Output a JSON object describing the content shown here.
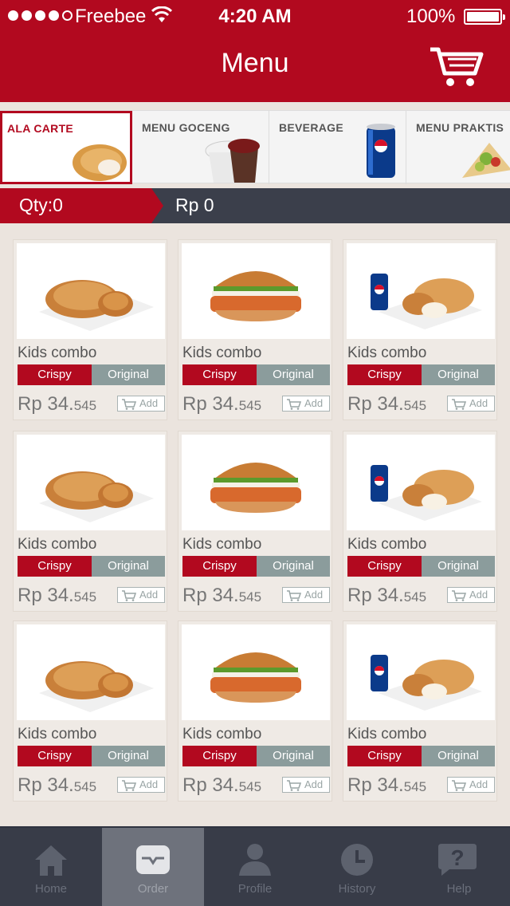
{
  "status": {
    "carrier": "Freebee",
    "time": "4:20 AM",
    "battery": "100%"
  },
  "header": {
    "title": "Menu"
  },
  "categories": [
    {
      "label": "ALA CARTE",
      "active": true
    },
    {
      "label": "MENU GOCENG",
      "active": false
    },
    {
      "label": "BEVERAGE",
      "active": false
    },
    {
      "label": "MENU PRAKTIS",
      "active": false
    }
  ],
  "summary": {
    "qty": "Qty:0",
    "total": "Rp 0"
  },
  "products": [
    {
      "name": "Kids combo",
      "option_a": "Crispy",
      "option_b": "Original",
      "price": "Rp 34.",
      "price_small": "545",
      "add": "Add",
      "image": "fried-chicken"
    },
    {
      "name": "Kids combo",
      "option_a": "Crispy",
      "option_b": "Original",
      "price": "Rp 34.",
      "price_small": "545",
      "add": "Add",
      "image": "chicken-burger"
    },
    {
      "name": "Kids combo",
      "option_a": "Crispy",
      "option_b": "Original",
      "price": "Rp 34.",
      "price_small": "545",
      "add": "Add",
      "image": "combo-with-pepsi"
    },
    {
      "name": "Kids combo",
      "option_a": "Crispy",
      "option_b": "Original",
      "price": "Rp 34.",
      "price_small": "545",
      "add": "Add",
      "image": "fried-chicken"
    },
    {
      "name": "Kids combo",
      "option_a": "Crispy",
      "option_b": "Original",
      "price": "Rp 34.",
      "price_small": "545",
      "add": "Add",
      "image": "chicken-burger"
    },
    {
      "name": "Kids combo",
      "option_a": "Crispy",
      "option_b": "Original",
      "price": "Rp 34.",
      "price_small": "545",
      "add": "Add",
      "image": "combo-with-pepsi"
    },
    {
      "name": "Kids combo",
      "option_a": "Crispy",
      "option_b": "Original",
      "price": "Rp 34.",
      "price_small": "545",
      "add": "Add",
      "image": "fried-chicken"
    },
    {
      "name": "Kids combo",
      "option_a": "Crispy",
      "option_b": "Original",
      "price": "Rp 34.",
      "price_small": "545",
      "add": "Add",
      "image": "chicken-burger"
    },
    {
      "name": "Kids combo",
      "option_a": "Crispy",
      "option_b": "Original",
      "price": "Rp 34.",
      "price_small": "545",
      "add": "Add",
      "image": "combo-with-pepsi"
    }
  ],
  "tabs": [
    {
      "label": "Home",
      "icon": "home-icon",
      "active": false
    },
    {
      "label": "Order",
      "icon": "order-tray-icon",
      "active": true
    },
    {
      "label": "Profile",
      "icon": "profile-icon",
      "active": false
    },
    {
      "label": "History",
      "icon": "clock-icon",
      "active": false
    },
    {
      "label": "Help",
      "icon": "help-icon",
      "active": false
    }
  ],
  "colors": {
    "brand_red": "#b2091f",
    "dark_bar": "#3b3f4b",
    "option_gray": "#8b9c9c",
    "background": "#ebe4de"
  }
}
